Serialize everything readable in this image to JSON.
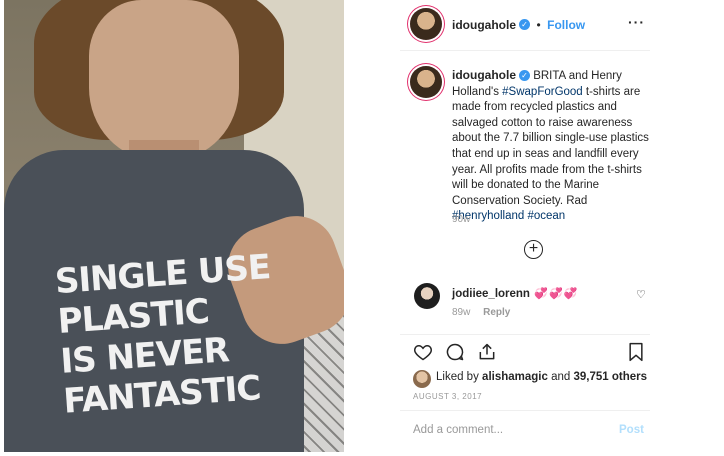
{
  "photo": {
    "shirt_text": [
      "SINGLE USE",
      "PLASTIC",
      "IS NEVER",
      "FANTASTIC"
    ]
  },
  "header": {
    "username": "idougahole",
    "separator": "•",
    "follow_label": "Follow",
    "more_label": "···"
  },
  "caption": {
    "username": "idougahole",
    "text_1": "BRITA and Henry Holland's",
    "tag_1": "#SwapForGood",
    "text_2": "t-shirts are made from recycled plastics and salvaged cotton to raise awareness about the 7.7 billion single-use plastics that end up in seas and landfill every year. All profits made from the t-shirts will be donated to the Marine Conservation Society. Rad",
    "tag_2": "#henryholland",
    "tag_3": "#ocean",
    "age": "90w"
  },
  "load_more": {
    "label": "+"
  },
  "comment": {
    "username": "jodiiee_lorenn",
    "text": "💞💞💞",
    "age": "89w",
    "reply_label": "Reply"
  },
  "likes": {
    "prefix": "Liked by",
    "user": "alishamagic",
    "connector": "and",
    "count": "39,751 others"
  },
  "date": "AUGUST 3, 2017",
  "add_comment": {
    "placeholder": "Add a comment...",
    "post_label": "Post"
  },
  "colors": {
    "link_blue": "#3897f0",
    "hashtag": "#003569",
    "post_disabled": "#b2dffc"
  }
}
